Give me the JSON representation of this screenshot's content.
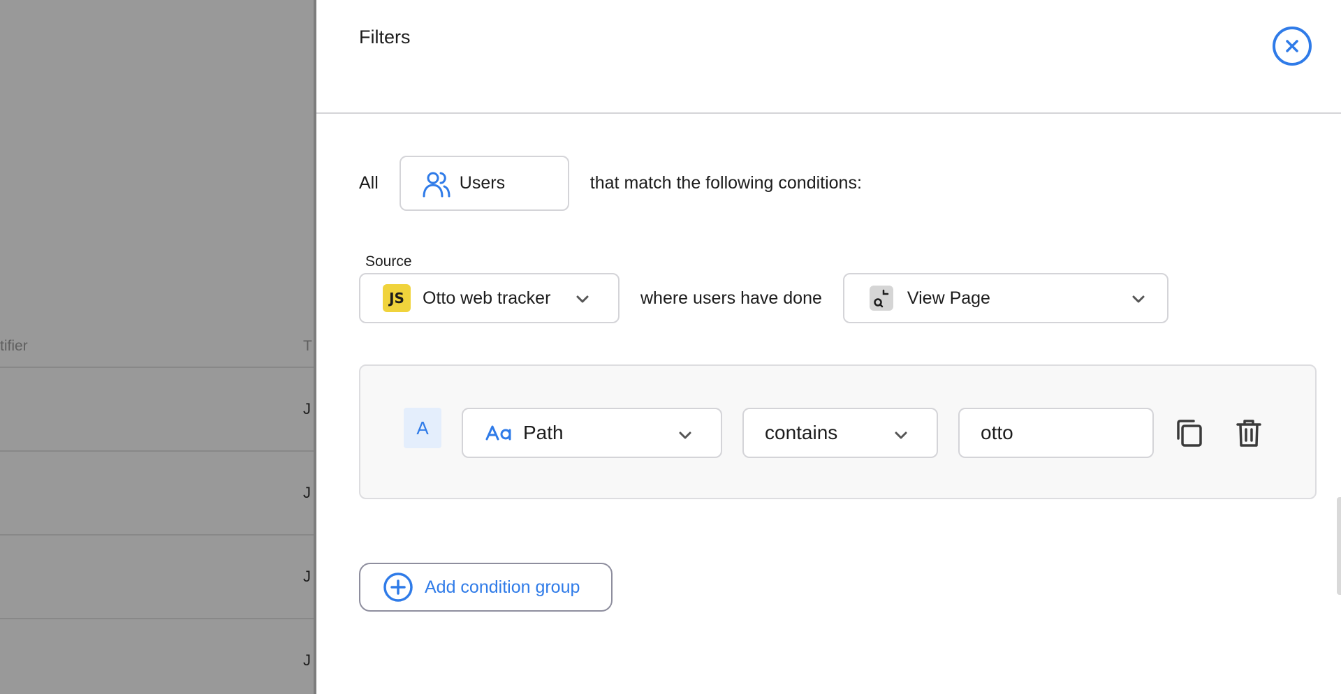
{
  "background_table": {
    "col1_header": "tifier",
    "col2_header": "T",
    "row_cells": [
      "J",
      "J",
      "J",
      "J"
    ]
  },
  "drawer": {
    "title": "Filters",
    "close_icon": "close-circle-icon"
  },
  "match_row": {
    "prefix": "All",
    "entity": "Users",
    "entity_icon": "users-icon",
    "suffix": "that match the following conditions:"
  },
  "source": {
    "label": "Source",
    "value": "Otto web tracker",
    "badge": "JS",
    "connector_text": "where users have done",
    "event": "View Page",
    "event_icon": "view-page-icon"
  },
  "condition": {
    "letter": "A",
    "property_icon": "text-type-icon",
    "property": "Path",
    "operator": "contains",
    "value": "otto",
    "copy_icon": "copy-icon",
    "delete_icon": "trash-icon"
  },
  "add_group": {
    "label": "Add condition group",
    "icon": "plus-circle-icon"
  },
  "colors": {
    "accent": "#2f7be8",
    "js_badge": "#f0d33c",
    "overlay": "#999999"
  }
}
